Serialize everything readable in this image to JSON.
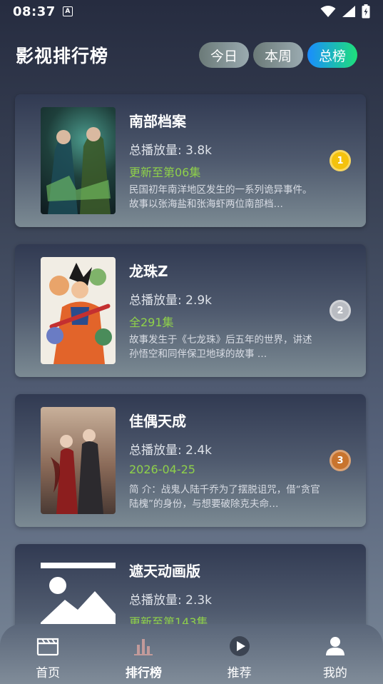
{
  "status": {
    "time": "08:37",
    "notif_letter": "A"
  },
  "header": {
    "title": "影视排行榜",
    "tabs": [
      {
        "label": "今日",
        "active": false
      },
      {
        "label": "本周",
        "active": false
      },
      {
        "label": "总榜",
        "active": true
      }
    ]
  },
  "list": [
    {
      "title": "南部档案",
      "plays": "总播放量: 3.8k",
      "subtitle": "更新至第06集",
      "description": "民国初年南洋地区发生的一系列诡异事件。故事以张海盐和张海虾两位南部档…",
      "rank": "1",
      "rank_color": "#f4c20d"
    },
    {
      "title": "龙珠Z",
      "plays": "总播放量: 2.9k",
      "subtitle": "全291集",
      "description": "故事发生于《七龙珠》后五年的世界，讲述孙悟空和同伴保卫地球的故事 …",
      "rank": "2",
      "rank_color": "#b9bcc2"
    },
    {
      "title": "佳偶天成",
      "plays": "总播放量: 2.4k",
      "subtitle": "2026-04-25",
      "description": "简 介：战鬼人陆千乔为了摆脱诅咒，借“贪官陆槐”的身份，与想要破除克夫命…",
      "rank": "3",
      "rank_color": "#c8742e"
    },
    {
      "title": "遮天动画版",
      "plays": "总播放量: 2.3k",
      "subtitle": "更新至第143集"
    }
  ],
  "nav": [
    {
      "label": "首页",
      "icon": "clapperboard-icon",
      "active": false
    },
    {
      "label": "排行榜",
      "icon": "bar-chart-icon",
      "active": true
    },
    {
      "label": "推荐",
      "icon": "play-circle-icon",
      "active": false
    },
    {
      "label": "我的",
      "icon": "user-icon",
      "active": false
    }
  ]
}
